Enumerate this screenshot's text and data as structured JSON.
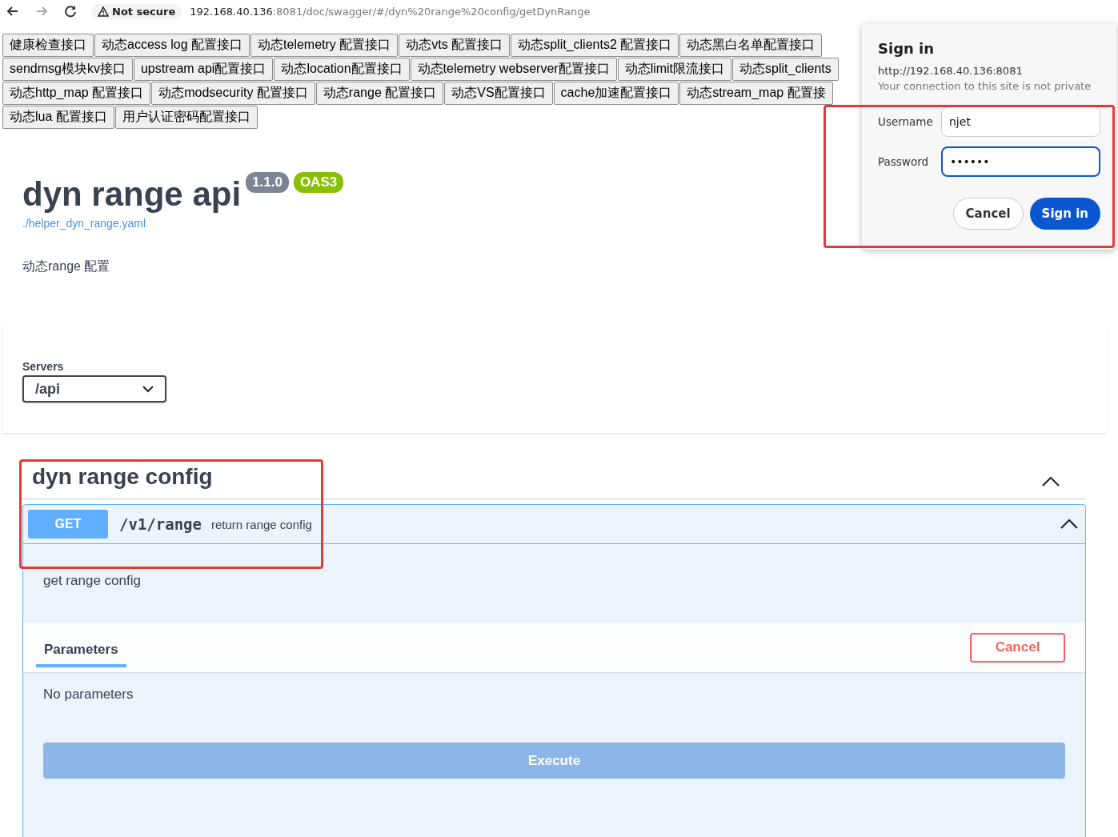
{
  "browser": {
    "security": "Not secure",
    "url_host": "192.168.40.136",
    "url_rest": ":8081/doc/swagger/#/dyn%20range%20config/getDynRange"
  },
  "api_links": [
    [
      "健康检查接口",
      "动态access log 配置接口",
      "动态telemetry 配置接口",
      "动态vts 配置接口",
      "动态split_clients2 配置接口",
      "动态黑白名单配置接口"
    ],
    [
      "sendmsg模块kv接口",
      "upstream api配置接口",
      "动态location配置接口",
      "动态telemetry webserver配置接口",
      "动态limit限流接口",
      "动态split_clients"
    ],
    [
      "动态http_map 配置接口",
      "动态modsecurity 配置接口",
      "动态range 配置接口",
      "动态VS配置接口",
      "cache加速配置接口",
      "动态stream_map 配置接"
    ],
    [
      "动态lua 配置接口",
      "用户认证密码配置接口"
    ]
  ],
  "info": {
    "title": "dyn range api",
    "version": "1.1.0",
    "spec": "OAS3",
    "link": "./helper_dyn_range.yaml",
    "description": "动态range 配置"
  },
  "servers": {
    "label": "Servers",
    "selected": "/api"
  },
  "tag_section": {
    "title": "dyn range config",
    "expanded": true,
    "operation": {
      "method": "GET",
      "path": "/v1/range",
      "summary": "return range config",
      "expanded": true,
      "description": "get range config",
      "tab": {
        "label": "Parameters",
        "selected": true
      },
      "cancel_button": "Cancel",
      "empty_text": "No parameters",
      "execute_button": {
        "label": "Execute",
        "disabled": true
      }
    }
  },
  "sign_in_dialog": {
    "title": "Sign in",
    "origin": "http://192.168.40.136:8081",
    "note": "Your connection to this site is not private",
    "fields": [
      {
        "label": "Username",
        "value": "njet",
        "focused": false
      },
      {
        "label": "Password",
        "value": "••••••",
        "focused": true
      }
    ],
    "buttons": [
      {
        "label": "Cancel",
        "kind": "secondary"
      },
      {
        "label": "Sign in",
        "kind": "primary"
      }
    ]
  }
}
